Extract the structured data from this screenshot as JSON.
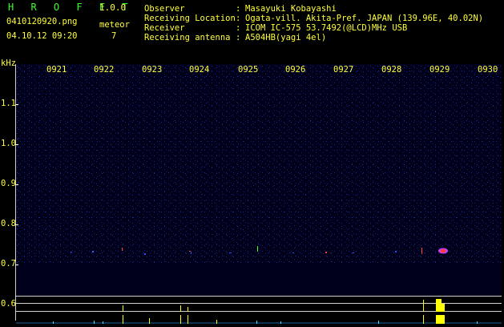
{
  "header": {
    "app_name": "H R O F F T",
    "version": "1.0.0",
    "file_name": "0410120920.png",
    "datetime": "04.10.12 09:20",
    "meteor_label": "meteor",
    "meteor_count": "7",
    "info": [
      {
        "key": "Observer",
        "sep": ":",
        "value": "Masayuki Kobayashi"
      },
      {
        "key": "Receiving Location",
        "sep": ":",
        "value": "Ogata-vill. Akita-Pref. JAPAN (139.96E, 40.02N)"
      },
      {
        "key": "Receiver",
        "sep": ":",
        "value": "ICOM IC-575 53.7492(@LCD)MHz USB"
      },
      {
        "key": "Receiving antenna",
        "sep": ":",
        "value": "A504HB(yagi 4el)"
      }
    ]
  },
  "axis": {
    "y_unit": "kHz",
    "y_labels": [
      "1.1",
      "1.0",
      "0.9",
      "0.8",
      "0.7",
      "0.6"
    ],
    "x_labels": [
      "0921",
      "0922",
      "0923",
      "0924",
      "0925",
      "0926",
      "0927",
      "0928",
      "0929",
      "0930"
    ]
  },
  "colors": {
    "brand": "#39ff2a",
    "text": "#ffff3a",
    "background": "#000000",
    "plot_background": "#00001a",
    "echo_red": "#ff2a2a",
    "echo_magenta": "#c040ff",
    "noise_blue": "#2a4aff",
    "strip_cyan": "#40e0ff",
    "strip_yellow": "#ffff00"
  }
}
